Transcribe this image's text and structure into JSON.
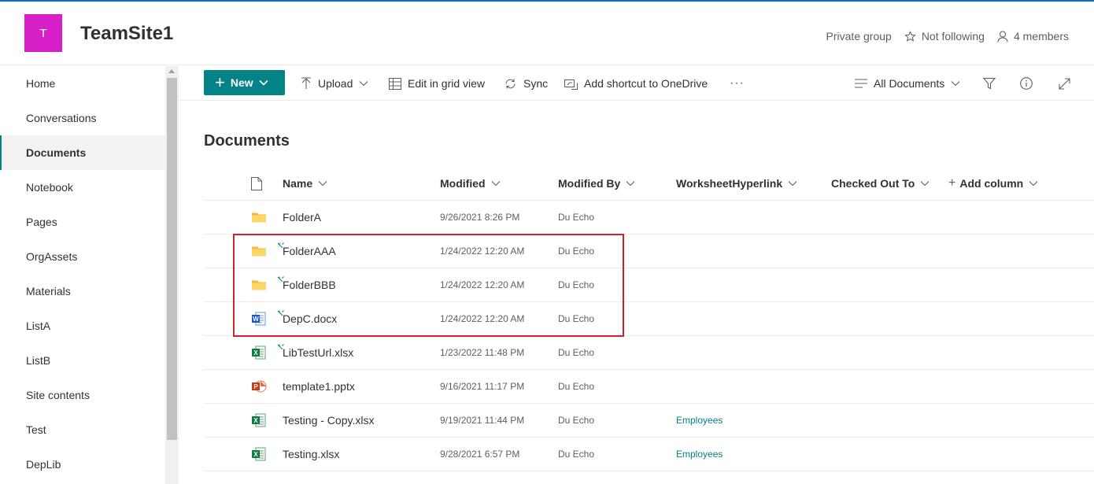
{
  "site": {
    "logo_letter": "T",
    "title": "TeamSite1",
    "privacy": "Private group",
    "follow_label": "Not following",
    "members_label": "4 members"
  },
  "nav": {
    "items": [
      {
        "label": "Home"
      },
      {
        "label": "Conversations"
      },
      {
        "label": "Documents",
        "selected": true
      },
      {
        "label": "Notebook"
      },
      {
        "label": "Pages"
      },
      {
        "label": "OrgAssets"
      },
      {
        "label": "Materials"
      },
      {
        "label": "ListA"
      },
      {
        "label": "ListB"
      },
      {
        "label": "Site contents"
      },
      {
        "label": "Test"
      },
      {
        "label": "DepLib"
      }
    ]
  },
  "commandbar": {
    "new_label": "New",
    "upload_label": "Upload",
    "edit_grid_label": "Edit in grid view",
    "sync_label": "Sync",
    "shortcut_label": "Add shortcut to OneDrive",
    "more_label": "···",
    "view_label": "All Documents"
  },
  "library": {
    "title": "Documents",
    "columns": {
      "name": "Name",
      "modified": "Modified",
      "modified_by": "Modified By",
      "worksheet": "WorksheetHyperlink",
      "checked_out": "Checked Out To",
      "add_column": "Add column"
    },
    "rows": [
      {
        "icon": "folder-icon",
        "name": "FolderA",
        "modified": "9/26/2021 8:26 PM",
        "by": "Du Echo",
        "worksheet": "",
        "new": false
      },
      {
        "icon": "folder-icon",
        "name": "FolderAAA",
        "modified": "1/24/2022 12:20 AM",
        "by": "Du Echo",
        "worksheet": "",
        "new": true
      },
      {
        "icon": "folder-icon",
        "name": "FolderBBB",
        "modified": "1/24/2022 12:20 AM",
        "by": "Du Echo",
        "worksheet": "",
        "new": true
      },
      {
        "icon": "word-doc-icon",
        "name": "DepC.docx",
        "modified": "1/24/2022 12:20 AM",
        "by": "Du Echo",
        "worksheet": "",
        "new": true
      },
      {
        "icon": "excel-file-icon",
        "name": "LibTestUrl.xlsx",
        "modified": "1/23/2022 11:48 PM",
        "by": "Du Echo",
        "worksheet": "",
        "new": true
      },
      {
        "icon": "powerpoint-file-icon",
        "name": "template1.pptx",
        "modified": "9/16/2021 11:17 PM",
        "by": "Du Echo",
        "worksheet": "",
        "new": false
      },
      {
        "icon": "excel-file-icon",
        "name": "Testing - Copy.xlsx",
        "modified": "9/19/2021 11:44 PM",
        "by": "Du Echo",
        "worksheet": "Employees",
        "new": false
      },
      {
        "icon": "excel-file-icon",
        "name": "Testing.xlsx",
        "modified": "9/28/2021 6:57 PM",
        "by": "Du Echo",
        "worksheet": "Employees",
        "new": false
      }
    ]
  },
  "colors": {
    "accent": "#038387",
    "logo": "#d61fc7",
    "highlight": "#d0202a"
  }
}
